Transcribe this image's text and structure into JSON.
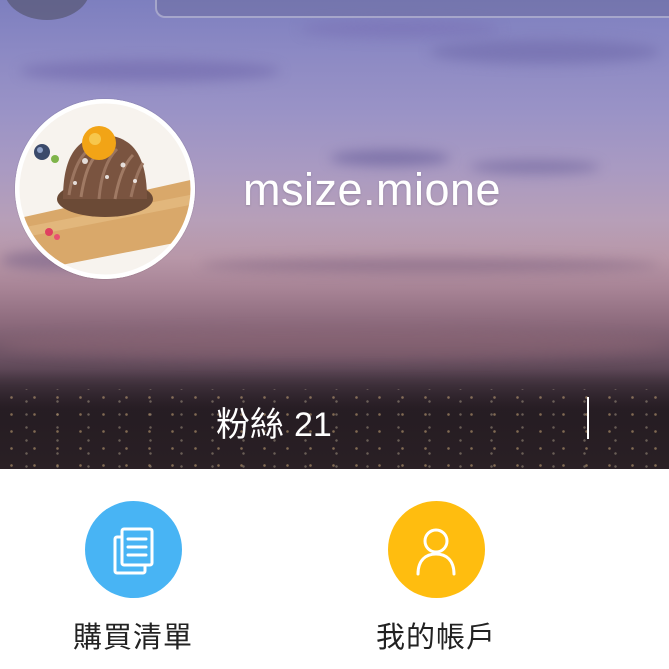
{
  "profile": {
    "username": "msize.mione",
    "followers_label": "粉絲",
    "followers_count": "21"
  },
  "menu": {
    "items": [
      {
        "label": "購買清單",
        "icon": "order-list-icon",
        "color": "#48b4f4"
      },
      {
        "label": "我的帳戶",
        "icon": "user-icon",
        "color": "#ffbd0f"
      }
    ]
  },
  "colors": {
    "sky_top": "#7d7fbf",
    "sky_bottom": "#261e23",
    "text_light": "#ffffff",
    "text_dark": "#222222"
  }
}
